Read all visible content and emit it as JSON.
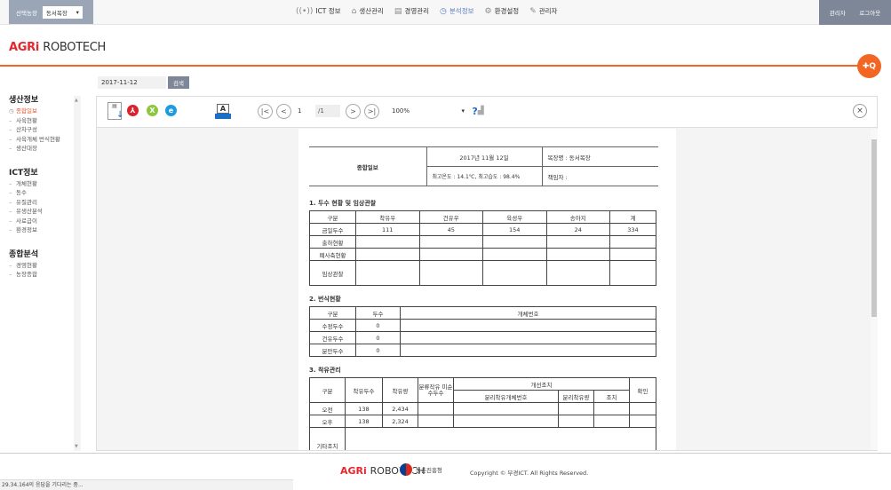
{
  "topbar": {
    "farm_label": "선택농장",
    "farm_selected": "동서목장",
    "nav": [
      {
        "icon": "wifi-icon",
        "glyph": "((•))",
        "label": "ICT 정보",
        "active": false
      },
      {
        "icon": "cow-icon",
        "glyph": "⌂",
        "label": "생산관리",
        "active": false
      },
      {
        "icon": "clipboard-icon",
        "glyph": "▤",
        "label": "경영관리",
        "active": false
      },
      {
        "icon": "clock-icon",
        "glyph": "◷",
        "label": "분석정보",
        "active": true
      },
      {
        "icon": "gear-icon",
        "glyph": "⚙",
        "label": "환경설정",
        "active": false
      },
      {
        "icon": "pin-icon",
        "glyph": "✎",
        "label": "관리자",
        "active": false
      }
    ],
    "user_label": "관리자",
    "logout_label": "로그아웃"
  },
  "logo": {
    "agri": "AGRi",
    "robo": "ROBOTECH"
  },
  "fab": {
    "glyph": "✚Q"
  },
  "search": {
    "date_value": "2017-11-12",
    "button_label": "검색"
  },
  "sidebar": {
    "sections": [
      {
        "title": "생산정보",
        "items": [
          {
            "label": "종합일보",
            "active": true
          },
          {
            "label": "사육현황",
            "active": false
          },
          {
            "label": "산차구성",
            "active": false
          },
          {
            "label": "사육개체 번식현황",
            "active": false
          },
          {
            "label": "생산대장",
            "active": false
          }
        ]
      },
      {
        "title": "ICT정보",
        "items": [
          {
            "label": "개체현황",
            "active": false
          },
          {
            "label": "동수",
            "active": false
          },
          {
            "label": "유질관리",
            "active": false
          },
          {
            "label": "유생산분석",
            "active": false
          },
          {
            "label": "사료급이",
            "active": false
          },
          {
            "label": "환경정보",
            "active": false
          }
        ]
      },
      {
        "title": "종합분석",
        "items": [
          {
            "label": "경영현황",
            "active": false
          },
          {
            "label": "농장종합",
            "active": false
          }
        ]
      }
    ]
  },
  "viewer": {
    "page_current": "1",
    "page_total": "/1",
    "zoom": "100%",
    "first_glyph": "|<",
    "prev_glyph": "<",
    "next_glyph": ">",
    "last_glyph": ">|",
    "close_glyph": "×"
  },
  "report": {
    "title": "종합일보",
    "date": "2017년 11월 12일",
    "farm_name": "목장명 :  동서목장",
    "climate": "최고온도 : 14.1℃, 최고습도 : 98.4%",
    "manager": "책임자 :",
    "section1": {
      "title": "1. 두수 현황 및 임상관찰",
      "headers": [
        "구분",
        "착유우",
        "건유우",
        "육성우",
        "송아지",
        "계"
      ],
      "rows": [
        [
          "금일두수",
          "111",
          "45",
          "154",
          "24",
          "334"
        ],
        [
          "출하현황",
          "",
          "",
          "",
          "",
          ""
        ],
        [
          "폐사축현황",
          "",
          "",
          "",
          "",
          ""
        ],
        [
          "임상관찰",
          "",
          "",
          "",
          "",
          ""
        ]
      ]
    },
    "section2": {
      "title": "2. 번식현황",
      "headers": [
        "구분",
        "두수",
        "개체번호"
      ],
      "rows": [
        [
          "수정두수",
          "0",
          ""
        ],
        [
          "건유두수",
          "0",
          ""
        ],
        [
          "분만두수",
          "0",
          ""
        ]
      ]
    },
    "section3": {
      "title": "3. 착유관리",
      "headers": [
        "구분",
        "착유두수",
        "착유량",
        "분류작유 미순수두수",
        "개선조치",
        "확인"
      ],
      "sub_headers": [
        "분리착유개체번호",
        "분리착유량",
        "조치"
      ],
      "rows": [
        [
          "오전",
          "138",
          "2,434",
          "",
          "",
          "",
          "",
          ""
        ],
        [
          "오후",
          "138",
          "2,324",
          "",
          "",
          "",
          "",
          ""
        ]
      ],
      "other_label": "기타조치"
    }
  },
  "footer": {
    "agri": "AGRi",
    "robo": "ROBOTECH",
    "gov": "농촌진흥청",
    "copyright": "Copyright © 부경ICT. All Rights Reserved."
  },
  "status": "29.34.164의 응답을 기다리는 중..."
}
